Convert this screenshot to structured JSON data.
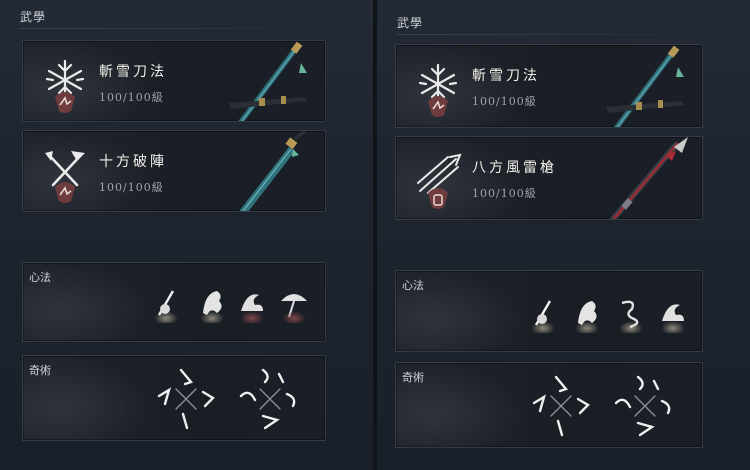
{
  "left_panel": {
    "title": "武學",
    "skills": [
      {
        "name": "斬雪刀法",
        "level": "100/100級",
        "icon": "snowflake-blade-emblem-icon",
        "weapon": "teal-sheathed-dao-icon"
      },
      {
        "name": "十方破陣",
        "level": "100/100級",
        "icon": "crossed-blades-emblem-icon",
        "weapon": "teal-blade-icon"
      }
    ],
    "heart_method_label": "心法",
    "heart_methods": [
      "swordsman-ink-icon",
      "horse-ink-icon",
      "wave-ink-icon",
      "umbrella-ink-icon"
    ],
    "mystic_arts_label": "奇術"
  },
  "right_panel": {
    "title": "武學",
    "skills": [
      {
        "name": "斬雪刀法",
        "level": "100/100級",
        "icon": "snowflake-blade-emblem-icon",
        "weapon": "teal-sheathed-dao-icon"
      },
      {
        "name": "八方風雷槍",
        "level": "100/100級",
        "icon": "spear-burst-emblem-icon",
        "weapon": "crimson-spear-icon"
      }
    ],
    "heart_method_label": "心法",
    "heart_methods": [
      "swordsman-ink-icon",
      "horse-ink-icon",
      "dragon-ink-icon",
      "wave-ink-icon"
    ],
    "mystic_arts_label": "奇術"
  },
  "colors": {
    "background": "#1b2029",
    "card": "#1c2028",
    "card_border": "#343b47",
    "text": "#f1efe9",
    "muted": "#9ea3ab",
    "badge": "#6e3c3c"
  }
}
